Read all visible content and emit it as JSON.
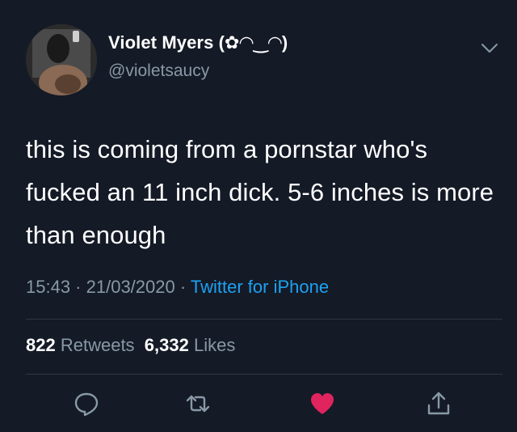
{
  "user": {
    "display_name": "Violet Myers (✿◠‿◠)",
    "handle": "@violetsaucy"
  },
  "tweet": {
    "text": "this is coming from a pornstar who's fucked an 11 inch dick. 5-6 inches is more than enough",
    "time": "15:43",
    "separator": " · ",
    "date": "21/03/2020",
    "source": "Twitter for iPhone"
  },
  "stats": {
    "retweets_count": "822",
    "retweets_label": "Retweets",
    "likes_count": "6,332",
    "likes_label": "Likes"
  },
  "icons": {
    "reply": "reply-icon",
    "retweet": "retweet-icon",
    "like": "heart-icon",
    "share": "share-icon",
    "more": "chevron-down-icon"
  },
  "colors": {
    "background": "#141a26",
    "secondary_text": "#8899a6",
    "link": "#1da1f2",
    "like": "#e0245e"
  }
}
